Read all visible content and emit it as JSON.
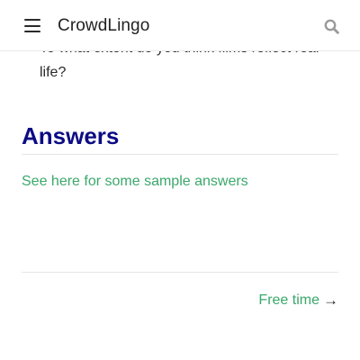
{
  "header": {
    "brand": "CrowdLingo"
  },
  "main": {
    "question": "To what extent do you think films reflect real life?",
    "answers_heading": "Answers",
    "sample_link": "See here for some sample answers"
  },
  "pagination": {
    "next_label": "Free time",
    "next_arrow": "→"
  },
  "colors": {
    "accent": "#3aa86b",
    "heading": "#0c0c84",
    "text": "#2a2a2a"
  },
  "icons": {
    "menu": "hamburger-menu-icon",
    "search": "search-icon",
    "arrow": "arrow-right-icon"
  }
}
